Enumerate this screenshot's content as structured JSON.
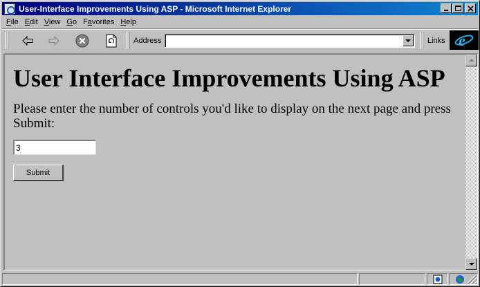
{
  "window": {
    "title": "User-Interface Improvements Using ASP  - Microsoft Internet Explorer"
  },
  "menu": {
    "items": [
      {
        "accel": "F",
        "rest": "ile"
      },
      {
        "accel": "E",
        "rest": "dit"
      },
      {
        "accel": "V",
        "rest": "iew"
      },
      {
        "accel": "G",
        "rest": "o"
      },
      {
        "accel": "",
        "rest": "F",
        "tail": "a",
        "rest2": "vorites"
      },
      {
        "accel": "H",
        "rest": "elp"
      }
    ]
  },
  "toolbar": {
    "address_label": "Address",
    "address_value": "",
    "links_label": "Links",
    "icons": [
      "back-arrow-icon",
      "forward-arrow-icon",
      "stop-icon",
      "refresh-icon",
      "ie-logo-icon"
    ]
  },
  "page": {
    "heading": "User Interface Improvements Using ASP",
    "instructions": "Please enter the number of controls you'd like to display on the next page and press Submit:",
    "input_value": "3",
    "submit_label": "Submit"
  },
  "status": {
    "text": ""
  },
  "colors": {
    "titlebar_start": "#000080",
    "titlebar_end": "#1084d0",
    "face": "#c0c0c0"
  }
}
